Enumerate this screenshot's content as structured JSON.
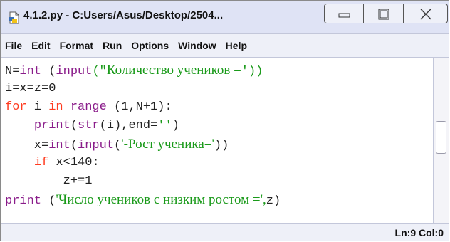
{
  "window": {
    "title": "4.1.2.py - C:Users/Asus/Desktop/2504...",
    "icon": "python-file-icon",
    "controls": [
      "minimize-icon",
      "maximize-icon",
      "close-icon"
    ]
  },
  "menubar": {
    "items": [
      {
        "label": "File"
      },
      {
        "label": "Edit"
      },
      {
        "label": "Format"
      },
      {
        "label": "Run"
      },
      {
        "label": "Options"
      },
      {
        "label": "Window"
      },
      {
        "label": "Help"
      }
    ]
  },
  "editor": {
    "lines": [
      {
        "text": "N=int (input(\"Количество учеников =')) "
      },
      {
        "text": "i=x=z=0"
      },
      {
        "text": "for i in range (1,N+1):"
      },
      {
        "text": "    print(str(i),end='')"
      },
      {
        "text": "    x=int(input('-Рост ученика='))"
      },
      {
        "text": "    if x<140:"
      },
      {
        "text": "        z+=1"
      },
      {
        "text": "print ('Число учеников с низким ростом =',z)"
      }
    ],
    "segments": {
      "l0": [
        "N=",
        "int",
        " (",
        "input",
        "(\"",
        "Количество учеников =",
        "'))"
      ],
      "l1": [
        "i=x=z=0"
      ],
      "l2": [
        "for",
        " i ",
        "in",
        " ",
        "range",
        " (1,N+1):"
      ],
      "l3": [
        "    ",
        "print",
        "(",
        "str",
        "(i),end=",
        "''",
        ")"
      ],
      "l4": [
        "    x=",
        "int",
        "(",
        "input",
        "(",
        "'-Рост ученика='",
        "))"
      ],
      "l5": [
        "    ",
        "if",
        " x<140:"
      ],
      "l6": [
        "        z+=1"
      ],
      "l7": [
        "print",
        " (",
        "'Число учеников с низким ростом =',",
        "z)"
      ]
    }
  },
  "statusbar": {
    "position": "Ln:9 Col:0"
  },
  "colors": {
    "keyword": "#ff3b1f",
    "builtin": "#8a1c8a",
    "string": "#1a9a1a",
    "titlebar": "#dfe3f5"
  }
}
